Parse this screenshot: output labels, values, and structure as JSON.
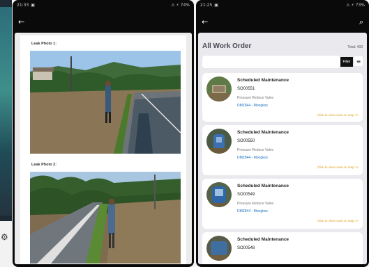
{
  "phone_a": {
    "status": {
      "time": "21:33",
      "signal": "⚠ ⚡ 74%"
    },
    "appbar": {
      "back_icon": "arrow-left-icon"
    },
    "photos": [
      {
        "label": "Leak Photo 1:"
      },
      {
        "label": "Leak Photo 2:"
      }
    ]
  },
  "phone_b": {
    "status": {
      "time": "21:25",
      "signal": "⚠ ⚡ 73%"
    },
    "appbar": {
      "back_icon": "arrow-left-icon",
      "search_icon": "search-icon"
    },
    "title": "All Work Order",
    "total": "Total: 433",
    "filter_label": "Filter",
    "work_orders": [
      {
        "title": "Scheduled Maintenance",
        "code": "SO00551",
        "type": "Pressure Reduce Valve",
        "location": "DMZ844 - Mongkos",
        "link": "Click to view route on map >>"
      },
      {
        "title": "Scheduled Maintenance",
        "code": "SO00550",
        "type": "Pressure Reduce Valve",
        "location": "DMZ844 - Mongkos",
        "link": "Click to view route on map >>"
      },
      {
        "title": "Scheduled Maintenance",
        "code": "SO00549",
        "type": "Pressure Reduce Valve",
        "location": "DMZ844 - Mongkos",
        "link": "Click to view route on map >>"
      },
      {
        "title": "Scheduled Maintenance",
        "code": "SO00548",
        "type": "",
        "location": "",
        "link": ""
      }
    ]
  },
  "colors": {
    "accent_link": "#1a6fc2",
    "map_link": "#e0a21a",
    "appbar": "#0a0a0a"
  }
}
